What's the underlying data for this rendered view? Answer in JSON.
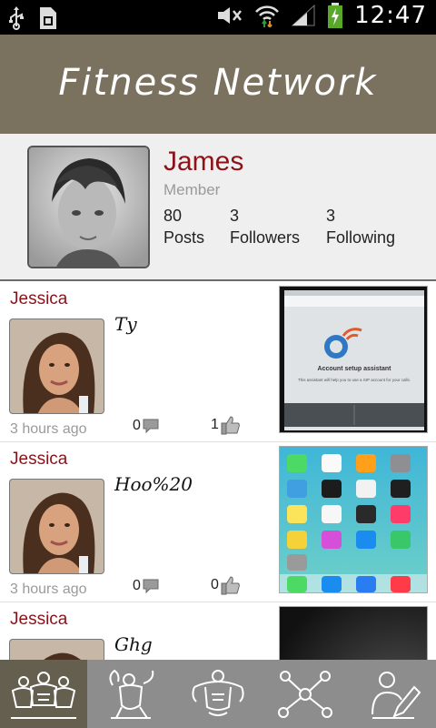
{
  "status_bar": {
    "time": "12:47"
  },
  "header": {
    "title": "Fitness Network"
  },
  "profile": {
    "name": "James",
    "role": "Member",
    "stats": [
      {
        "value": "80",
        "label": "Posts"
      },
      {
        "value": "3",
        "label": "Followers"
      },
      {
        "value": "3",
        "label": "Following"
      }
    ]
  },
  "feed": {
    "posts": [
      {
        "author": "Jessica",
        "text": "Ty",
        "time": "3 hours ago",
        "comments": "0",
        "likes": "1",
        "image": {
          "title": "Account setup assistant",
          "caption": "This assistant will help you to use a SIP account for your calls."
        }
      },
      {
        "author": "Jessica",
        "text": "Hoo%20",
        "time": "3 hours ago",
        "comments": "0",
        "likes": "0",
        "image": {
          "title": "",
          "caption": ""
        }
      },
      {
        "author": "Jessica",
        "text": "Ghg",
        "time": "",
        "comments": "",
        "likes": "",
        "image": {
          "title": "",
          "caption": ""
        }
      }
    ]
  },
  "bottom_nav": {
    "items": [
      {
        "icon": "group-bodybuilders-icon",
        "active": true
      },
      {
        "icon": "flexing-man-icon",
        "active": false
      },
      {
        "icon": "bodybuilder-icon",
        "active": false
      },
      {
        "icon": "network-icon",
        "active": false
      },
      {
        "icon": "edit-profile-icon",
        "active": false
      }
    ]
  },
  "colors": {
    "header": "#7b715f",
    "name_accent": "#8c1218",
    "nav_bg": "#8d8d8d",
    "nav_active": "#655f4f"
  }
}
